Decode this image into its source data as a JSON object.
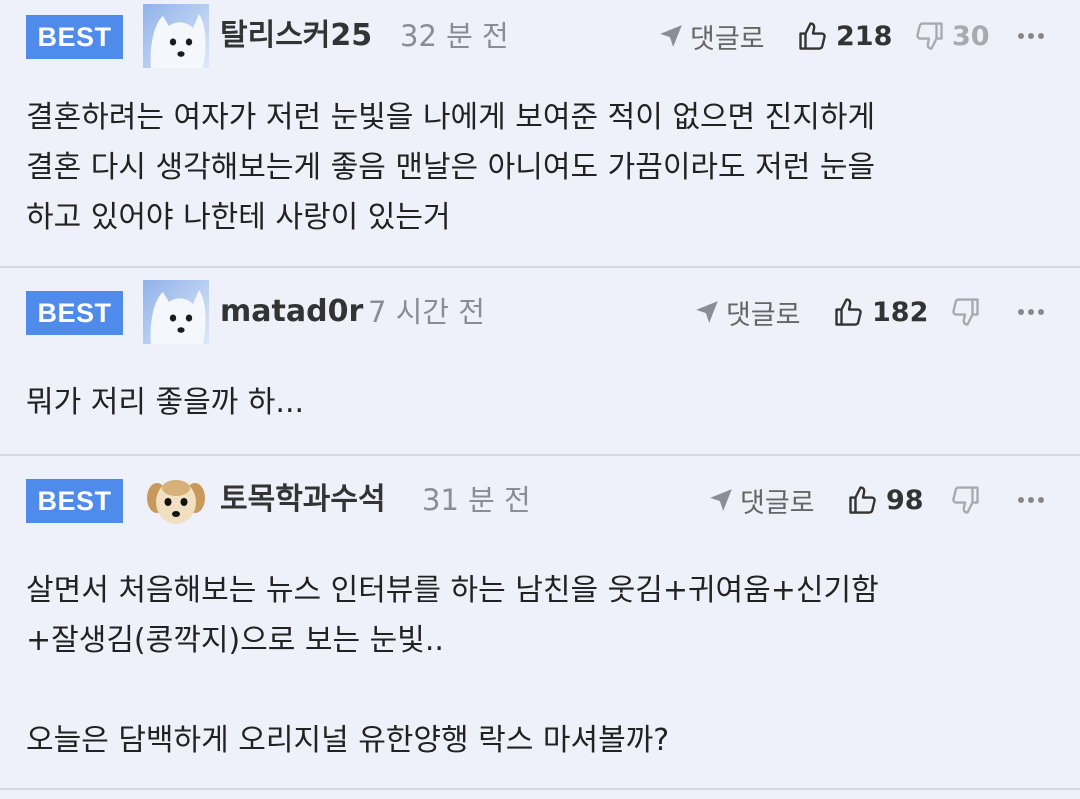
{
  "colors": {
    "badge": "#4f8bea",
    "background": "#eef1fa",
    "divider": "#d6d9e2"
  },
  "comments": [
    {
      "badge": "BEST",
      "avatar": "white-dog-avatar-icon",
      "username": "탈리스커25",
      "time": "32 분 전",
      "reply_label": "댓글로",
      "likes": "218",
      "dislikes": "30",
      "body": [
        "결혼하려는 여자가 저런 눈빛을 나에게 보여준 적이 없으면 진지하게",
        "결혼 다시 생각해보는게 좋음 맨날은 아니여도 가끔이라도 저런 눈을",
        "하고 있어야 나한테 사랑이 있는거"
      ]
    },
    {
      "badge": "BEST",
      "avatar": "white-dog-avatar-icon",
      "username": "matad0r",
      "time": "7 시간 전",
      "reply_label": "댓글로",
      "likes": "182",
      "dislikes": "",
      "body": [
        "뭐가 저리 좋을까 하..."
      ]
    },
    {
      "badge": "BEST",
      "avatar": "puppy-avatar-icon",
      "username": "토목학과수석",
      "time": "31 분 전",
      "reply_label": "댓글로",
      "likes": "98",
      "dislikes": "",
      "body": [
        "살면서 처음해보는 뉴스 인터뷰를 하는 남친을 웃김+귀여움+신기함",
        "+잘생김(콩깍지)으로 보는 눈빛..",
        "",
        "오늘은 담백하게 오리지널 유한양행 락스 마셔볼까?"
      ]
    }
  ]
}
